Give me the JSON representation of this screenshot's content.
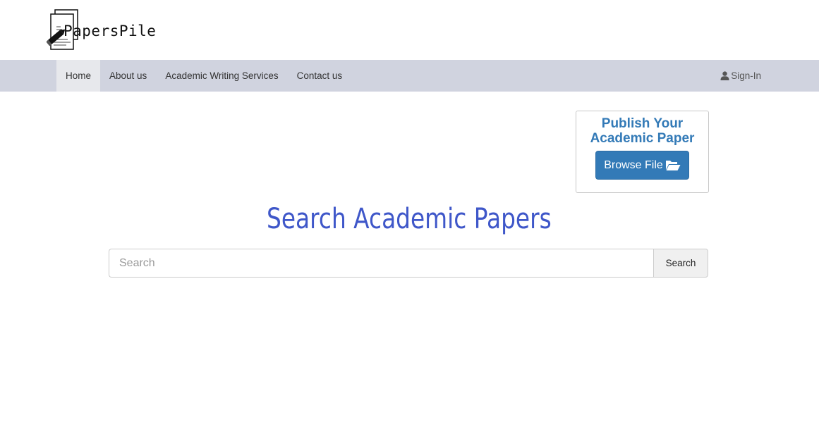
{
  "brand": {
    "name": "PapersPile"
  },
  "nav": {
    "items": [
      {
        "label": "Home",
        "active": true
      },
      {
        "label": "About us"
      },
      {
        "label": "Academic Writing Services"
      },
      {
        "label": "Contact us"
      }
    ],
    "signin_label": "Sign-In"
  },
  "publish": {
    "title_line1": "Publish Your",
    "title_line2": "Academic Paper",
    "browse_label": "Browse File"
  },
  "search": {
    "heading": "Search Academic Papers",
    "placeholder": "Search",
    "button_label": "Search"
  },
  "colors": {
    "navbar_bg": "#d0d3df",
    "accent": "#337ab7",
    "heading": "#3f57c9"
  },
  "icons": {
    "logo": "papers-pen-icon",
    "signin": "user-icon",
    "browse": "folder-open-icon"
  }
}
